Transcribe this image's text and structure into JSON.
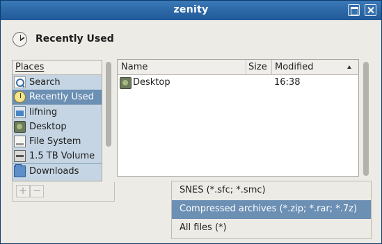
{
  "window": {
    "title": "zenity"
  },
  "location": {
    "title": "Recently Used",
    "icon": "clock-icon"
  },
  "places": {
    "header": "Places",
    "items": [
      {
        "label": "Search",
        "icon": "search-icon"
      },
      {
        "label": "Recently Used",
        "icon": "recent-icon",
        "selected": true
      },
      {
        "label": "lifning",
        "icon": "home-folder-icon"
      },
      {
        "label": "Desktop",
        "icon": "desktop-icon"
      },
      {
        "label": "File System",
        "icon": "filesystem-icon"
      },
      {
        "label": "1.5 TB Volume",
        "icon": "drive-icon"
      },
      {
        "label": "Downloads",
        "icon": "folder-icon"
      }
    ],
    "add_label": "+",
    "remove_label": "−"
  },
  "files": {
    "columns": {
      "name": "Name",
      "size": "Size",
      "modified": "Modified"
    },
    "rows": [
      {
        "name": "Desktop",
        "size": "",
        "modified": "16:38",
        "icon": "desktop-icon"
      }
    ]
  },
  "filter_dropdown": {
    "options": [
      {
        "label": "SNES (*.sfc; *.smc)"
      },
      {
        "label": "Compressed archives (*.zip; *.rar; *.7z)",
        "selected": true
      },
      {
        "label": "All files (*)"
      }
    ]
  },
  "colors": {
    "selection": "#6c8fb4",
    "titlebar": "#2a65a3",
    "places_bg": "#c5d5e3"
  }
}
